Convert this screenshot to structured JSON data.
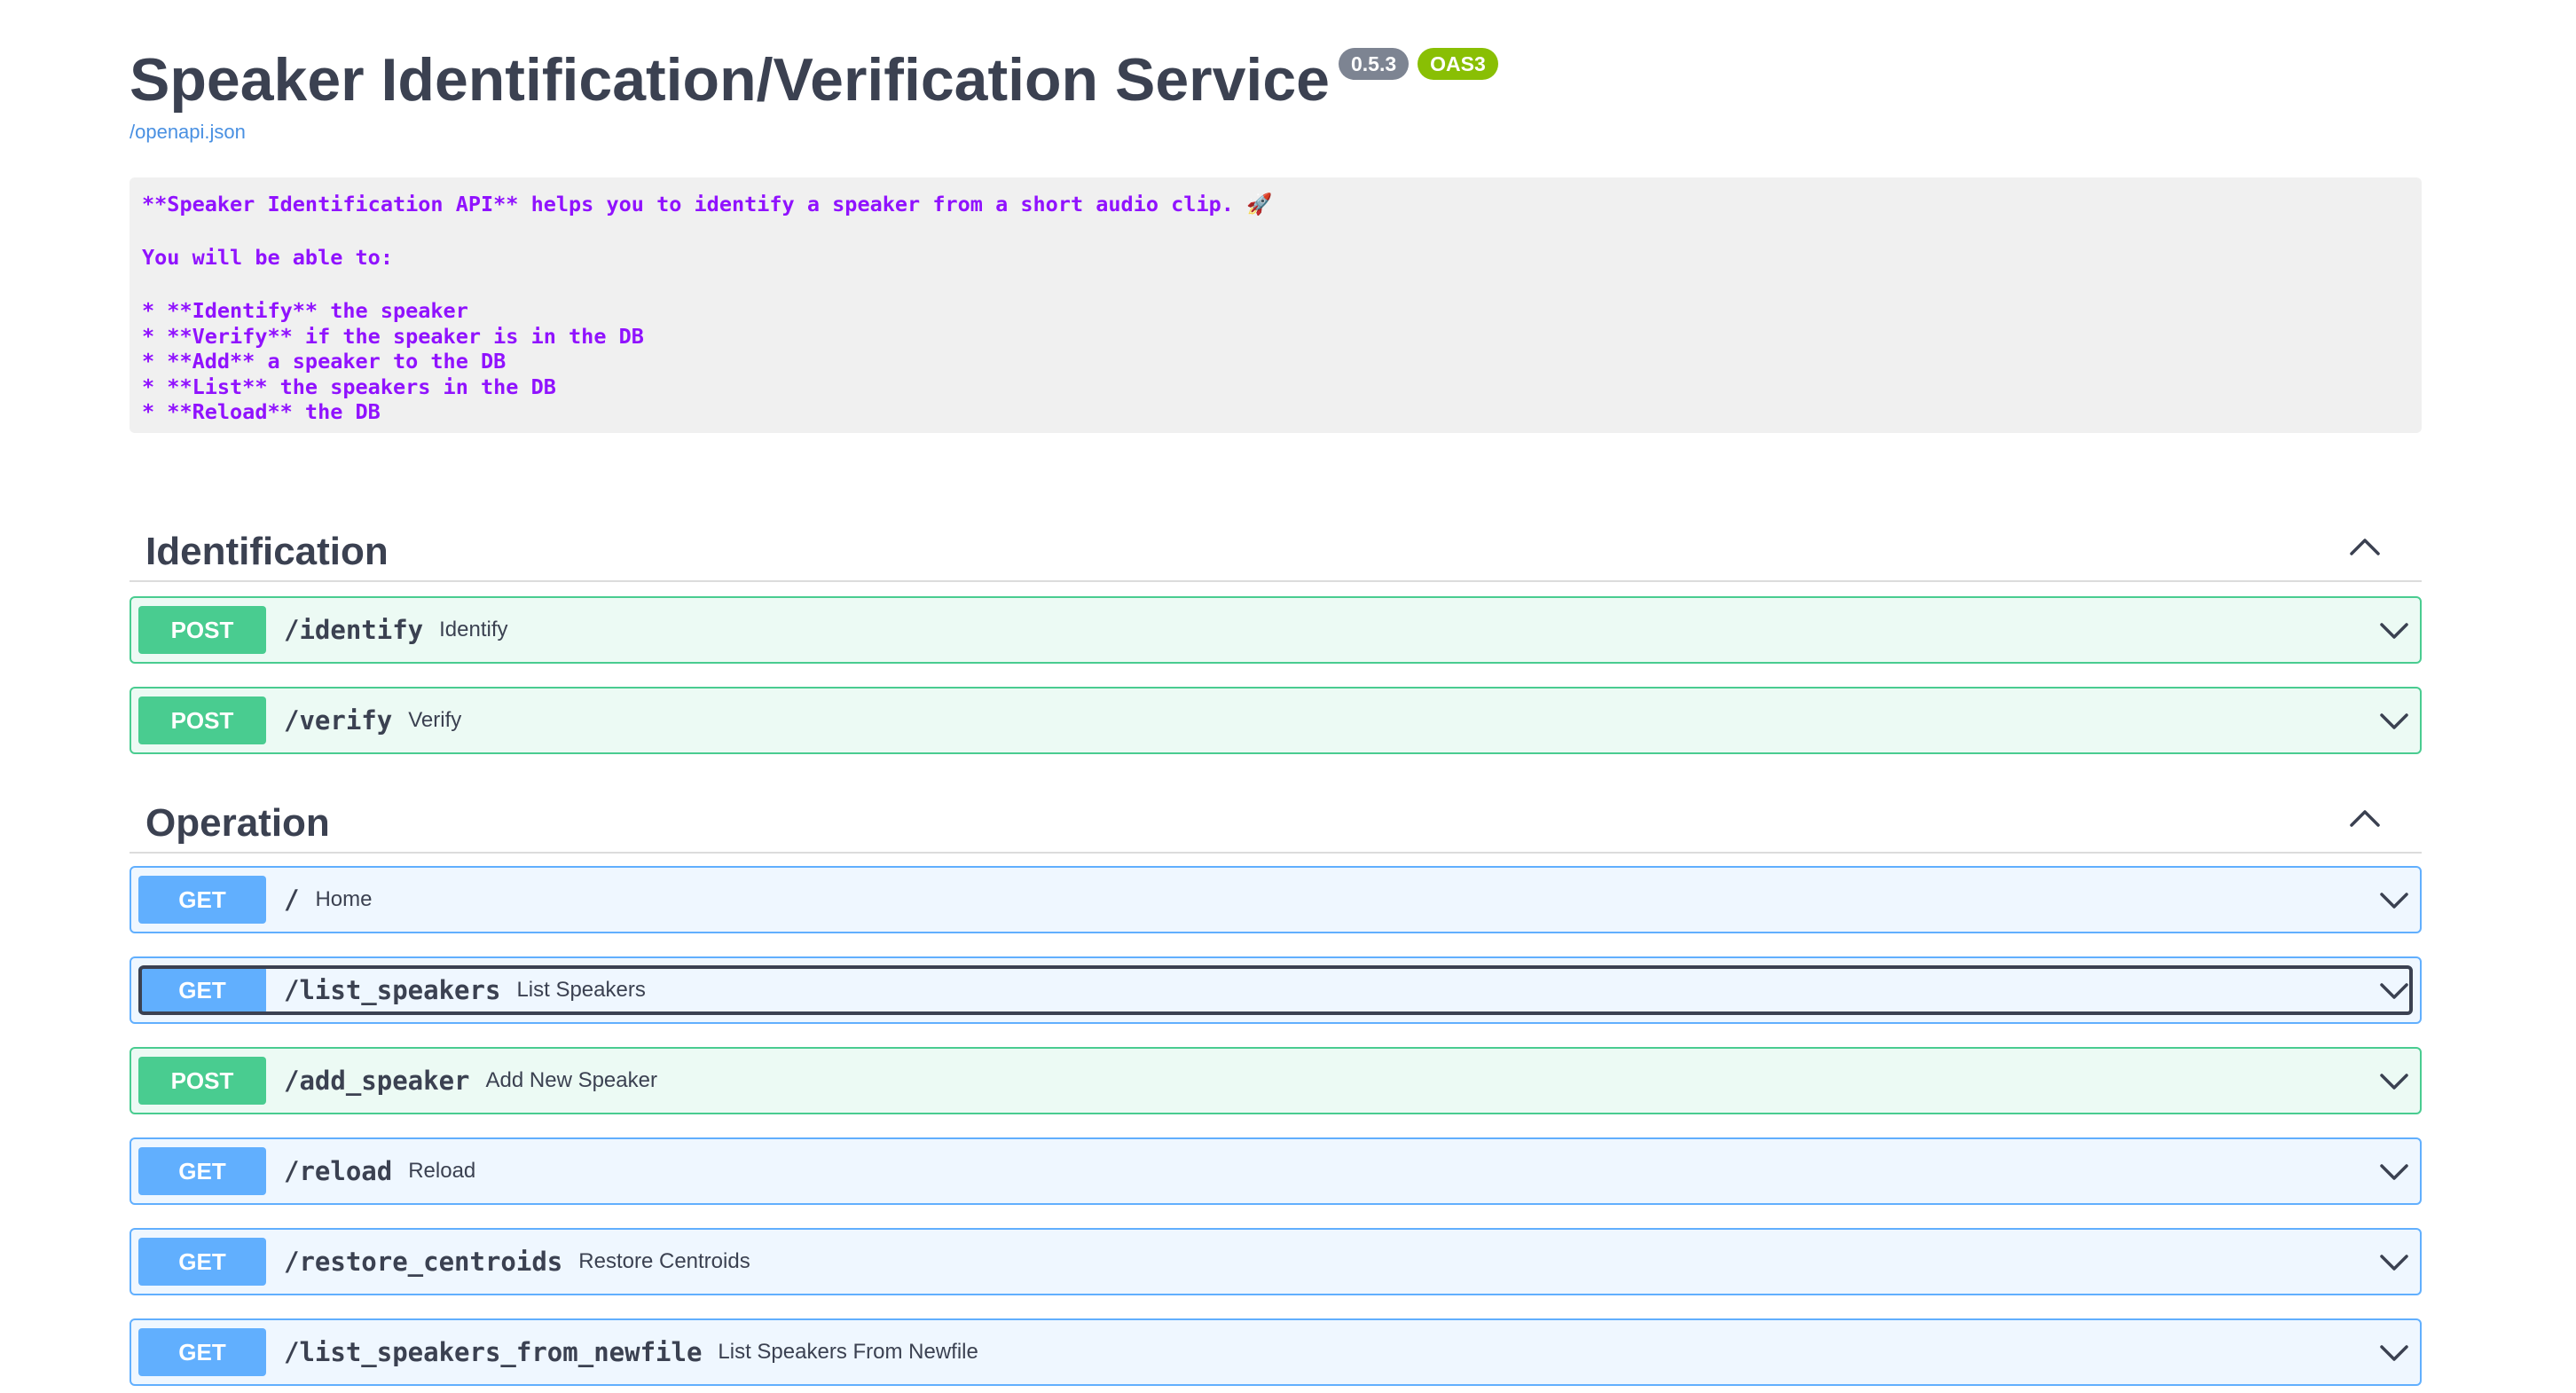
{
  "info": {
    "title": "Speaker Identification/Verification Service",
    "version": "0.5.3",
    "oas": "OAS3",
    "spec_link": "/openapi.json"
  },
  "description": {
    "intro": "**Speaker Identification API** helps you to identify a speaker from a short audio clip. 🚀",
    "lead": "You will be able to:",
    "bullets": [
      "* **Identify** the speaker",
      "* **Verify** if the speaker is in the DB",
      "* **Add** a speaker to the DB",
      "* **List** the speakers in the DB",
      "* **Reload** the DB"
    ]
  },
  "tags": [
    {
      "name": "Identification",
      "expanded": true,
      "operations": [
        {
          "method": "POST",
          "path": "/identify",
          "summary": "Identify"
        },
        {
          "method": "POST",
          "path": "/verify",
          "summary": "Verify"
        }
      ]
    },
    {
      "name": "Operation",
      "expanded": true,
      "operations": [
        {
          "method": "GET",
          "path": "/",
          "summary": "Home"
        },
        {
          "method": "GET",
          "path": "/list_speakers",
          "summary": "List Speakers",
          "focused": true
        },
        {
          "method": "POST",
          "path": "/add_speaker",
          "summary": "Add New Speaker"
        },
        {
          "method": "GET",
          "path": "/reload",
          "summary": "Reload"
        },
        {
          "method": "GET",
          "path": "/restore_centroids",
          "summary": "Restore Centroids"
        },
        {
          "method": "GET",
          "path": "/list_speakers_from_newfile",
          "summary": "List Speakers From Newfile"
        }
      ]
    }
  ],
  "icons": {
    "collapse": "chevron-up-icon",
    "expand": "chevron-down-icon"
  },
  "colors": {
    "post": "#49cc90",
    "get": "#61affe",
    "description_text": "#9012fe",
    "version_badge": "#7d8492",
    "oas_badge": "#89bf04"
  }
}
